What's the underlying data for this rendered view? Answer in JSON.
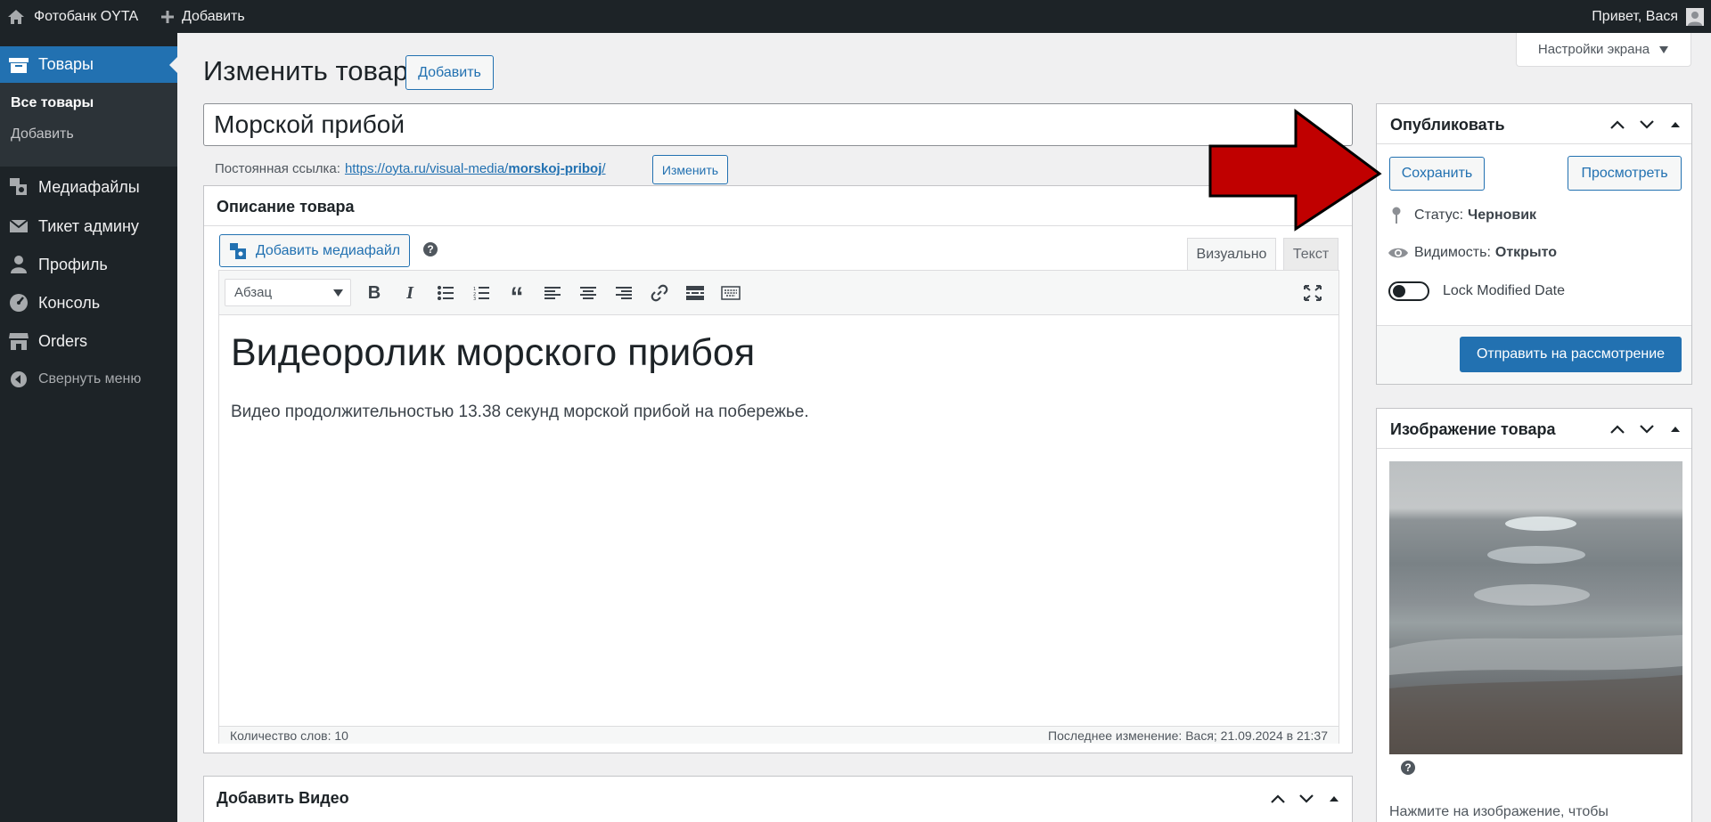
{
  "adminbar": {
    "site_name": "Фотобанк OYTA",
    "add_label": "Добавить",
    "greeting": "Привет, Вася"
  },
  "screen_options": {
    "label": "Настройки экрана"
  },
  "sidebar": {
    "active": {
      "label": "Товары"
    },
    "submenu": [
      {
        "label": "Все товары"
      },
      {
        "label": "Добавить"
      }
    ],
    "items": [
      {
        "label": "Медиафайлы"
      },
      {
        "label": "Тикет админу"
      },
      {
        "label": "Профиль"
      },
      {
        "label": "Консоль"
      },
      {
        "label": "Orders"
      },
      {
        "label": "Свернуть меню"
      }
    ]
  },
  "page": {
    "title": "Изменить товар",
    "add_button": "Добавить",
    "product_title": "Морской прибой",
    "permalink": {
      "label": "Постоянная ссылка:",
      "url_base": "https://oyta.ru/visual-media/",
      "url_slug": "morskoj-priboj",
      "url_end": "/",
      "edit_button": "Изменить"
    }
  },
  "editor": {
    "box_title": "Описание товара",
    "add_media": "Добавить медиафайл",
    "tabs": {
      "visual": "Визуально",
      "text": "Текст"
    },
    "format_select": "Абзац",
    "heading": "Видеоролик морского прибоя",
    "paragraph": "Видео продолжительностью 13.38 секунд морской прибой на побережье.",
    "word_count": "Количество слов: 10",
    "last_modified": "Последнее изменение: Вася; 21.09.2024 в 21:37"
  },
  "video_box": {
    "title": "Добавить Видео"
  },
  "publish": {
    "title": "Опубликовать",
    "save": "Сохранить",
    "preview": "Просмотреть",
    "status_label": "Статус:",
    "status_value": "Черновик",
    "visibility_label": "Видимость:",
    "visibility_value": "Открыто",
    "lock_label": "Lock Modified Date",
    "submit": "Отправить на рассмотрение"
  },
  "image_box": {
    "title": "Изображение товара",
    "hint": "Нажмите на изображение, чтобы"
  },
  "colors": {
    "accent": "#2271b1",
    "admin_dark": "#1d2327",
    "arrow_red": "#c00000"
  }
}
